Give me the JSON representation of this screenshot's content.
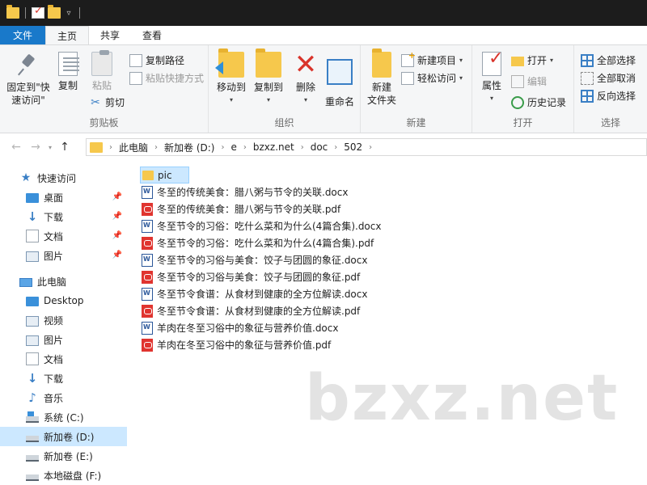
{
  "titlebar": {
    "quick_access_icons": [
      "folder-icon",
      "properties-icon",
      "new-folder-icon",
      "customize-dropdown-icon"
    ]
  },
  "ribbon_tabs": {
    "file": "文件",
    "home": "主页",
    "share": "共享",
    "view": "查看"
  },
  "ribbon": {
    "clipboard": {
      "label": "剪贴板",
      "pin_line1": "固定到\"快",
      "pin_line2": "速访问\"",
      "copy": "复制",
      "paste": "粘贴",
      "copy_path": "复制路径",
      "paste_shortcut": "粘贴快捷方式",
      "cut": "剪切"
    },
    "organize": {
      "label": "组织",
      "move_to": "移动到",
      "copy_to": "复制到",
      "delete": "删除",
      "rename": "重命名"
    },
    "new": {
      "label": "新建",
      "new_folder_line1": "新建",
      "new_folder_line2": "文件夹",
      "new_item": "新建项目",
      "easy_access": "轻松访问"
    },
    "open": {
      "label": "打开",
      "properties": "属性",
      "open": "打开",
      "edit": "编辑",
      "history": "历史记录"
    },
    "select": {
      "label": "选择",
      "select_all": "全部选择",
      "select_none": "全部取消",
      "invert": "反向选择"
    }
  },
  "address": {
    "crumbs": [
      "此电脑",
      "新加卷 (D:)",
      "e",
      "bzxz.net",
      "doc",
      "502"
    ]
  },
  "nav": {
    "quick_access": "快速访问",
    "quick_items": [
      "桌面",
      "下载",
      "文档",
      "图片"
    ],
    "this_pc": "此电脑",
    "pc_items": [
      "Desktop",
      "视频",
      "图片",
      "文档",
      "下载",
      "音乐",
      "系统 (C:)",
      "新加卷 (D:)",
      "新加卷 (E:)",
      "本地磁盘 (F:)"
    ]
  },
  "files": [
    {
      "name": "pic",
      "type": "folder"
    },
    {
      "name": "冬至的传统美食：腊八粥与节令的关联.docx",
      "type": "word"
    },
    {
      "name": "冬至的传统美食：腊八粥与节令的关联.pdf",
      "type": "pdf"
    },
    {
      "name": "冬至节令的习俗：吃什么菜和为什么(4篇合集).docx",
      "type": "word"
    },
    {
      "name": "冬至节令的习俗：吃什么菜和为什么(4篇合集).pdf",
      "type": "pdf"
    },
    {
      "name": "冬至节令的习俗与美食：饺子与团圆的象征.docx",
      "type": "word"
    },
    {
      "name": "冬至节令的习俗与美食：饺子与团圆的象征.pdf",
      "type": "pdf"
    },
    {
      "name": "冬至节令食谱：从食材到健康的全方位解读.docx",
      "type": "word"
    },
    {
      "name": "冬至节令食谱：从食材到健康的全方位解读.pdf",
      "type": "pdf"
    },
    {
      "name": "羊肉在冬至习俗中的象征与营养价值.docx",
      "type": "word"
    },
    {
      "name": "羊肉在冬至习俗中的象征与营养价值.pdf",
      "type": "pdf"
    }
  ],
  "watermark": "bzxz.net",
  "colors": {
    "accent": "#1979ca",
    "selection": "#cce8ff",
    "folder": "#f6c84c",
    "pdf": "#e0342f",
    "word": "#2b579a"
  }
}
